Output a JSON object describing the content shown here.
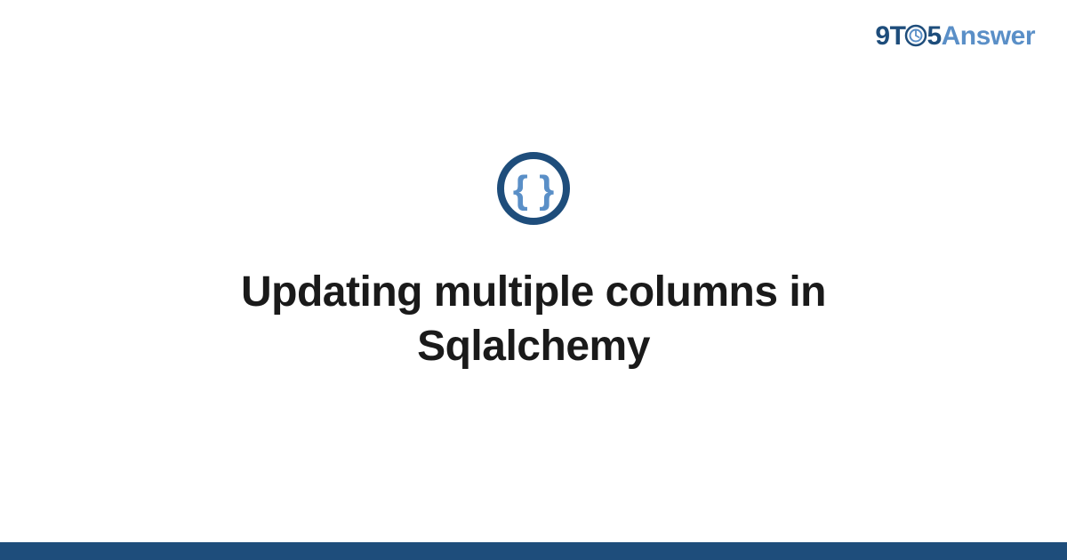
{
  "brand": {
    "part1": "9T",
    "part2": "5",
    "part3": "Answer"
  },
  "title": "Updating multiple columns in Sqlalchemy",
  "colors": {
    "primary": "#1e4d7b",
    "secondary": "#5a8fc7",
    "text": "#1a1a1a"
  }
}
